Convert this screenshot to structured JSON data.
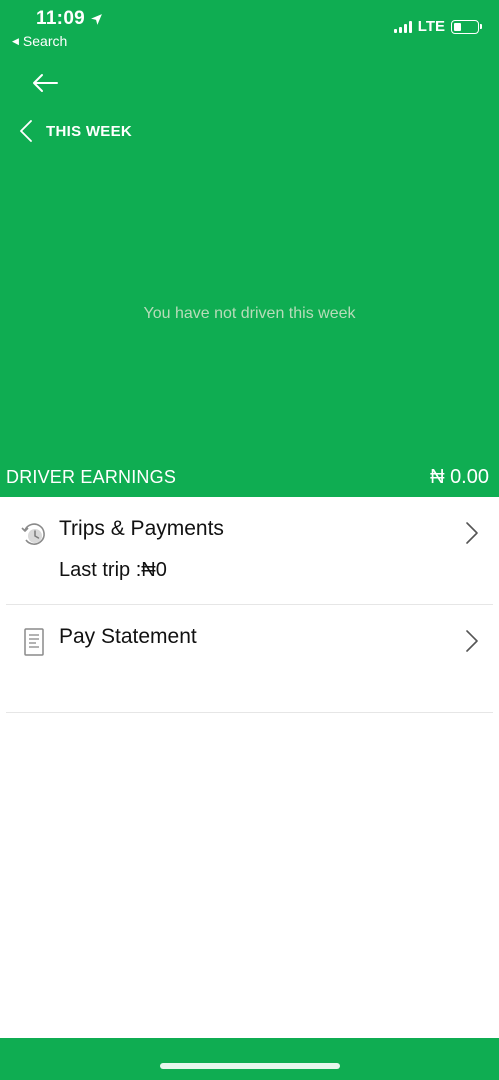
{
  "status_bar": {
    "time": "11:09",
    "back_app": "Search",
    "network": "LTE",
    "battery_level": 0.3
  },
  "header": {
    "period_label": "THIS WEEK",
    "empty_message": "You have not driven this week",
    "earnings_label": "DRIVER EARNINGS",
    "earnings_amount": "₦ 0.00"
  },
  "list": {
    "items": [
      {
        "title": "Trips & Payments",
        "subtitle": "Last trip :₦0",
        "icon": "history-clock-icon"
      },
      {
        "title": "Pay Statement",
        "subtitle": "",
        "icon": "receipt-icon"
      }
    ]
  },
  "colors": {
    "brand_green": "#0fad52",
    "muted_text": "#b7dcb9"
  }
}
